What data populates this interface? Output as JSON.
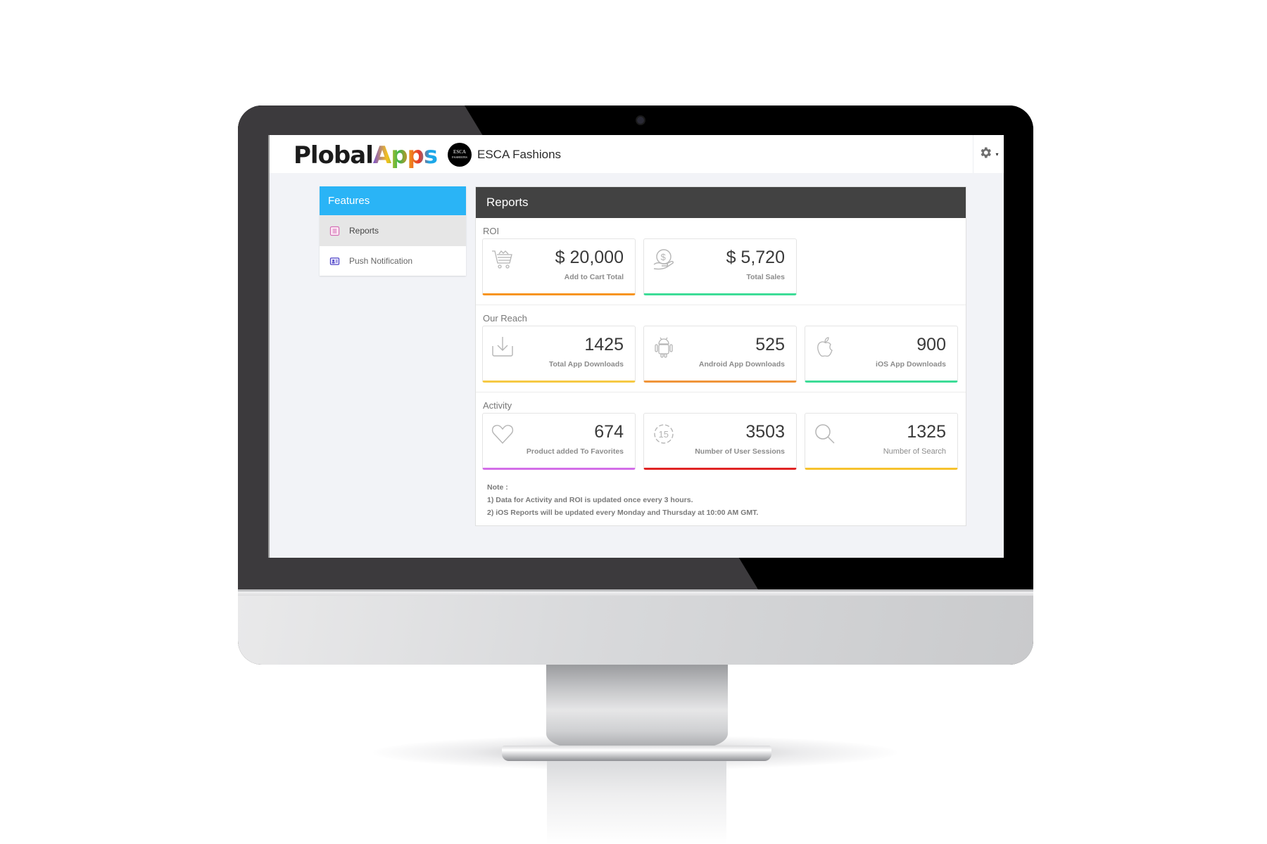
{
  "app": {
    "brand_prefix": "Plobal",
    "brand_suffix": "Apps",
    "store_logo_line1": "ESCA",
    "store_logo_line2": "FASHIONS",
    "store_name": "ESCA Fashions",
    "settings_caret": "▾"
  },
  "sidebar": {
    "title": "Features",
    "items": [
      {
        "label": "Reports",
        "icon": "report-list-icon",
        "active": true
      },
      {
        "label": "Push Notification",
        "icon": "id-card-icon",
        "active": false
      }
    ]
  },
  "reports": {
    "title": "Reports",
    "sections": [
      {
        "title": "ROI",
        "cards": [
          {
            "value": "$ 20,000",
            "label": "Add to Cart Total",
            "icon": "shopping-cart-icon",
            "accent": "#f7941d"
          },
          {
            "value": "$ 5,720",
            "label": "Total Sales",
            "icon": "money-hand-icon",
            "accent": "#3ddc97"
          }
        ]
      },
      {
        "title": "Our Reach",
        "cards": [
          {
            "value": "1425",
            "label": "Total App Downloads",
            "icon": "download-icon",
            "accent": "#f6c944"
          },
          {
            "value": "525",
            "label": "Android App Downloads",
            "icon": "android-icon",
            "accent": "#f0953a"
          },
          {
            "value": "900",
            "label": "iOS App Downloads",
            "icon": "apple-icon",
            "accent": "#3ddc97"
          }
        ]
      },
      {
        "title": "Activity",
        "cards": [
          {
            "value": "674",
            "label": "Product added To Favorites",
            "icon": "heart-icon",
            "accent": "#d36ee8"
          },
          {
            "value": "3503",
            "label": "Number of User Sessions",
            "icon": "timer-15-icon",
            "accent": "#e02424"
          },
          {
            "value": "1325",
            "label": "Number of Search",
            "icon": "search-icon",
            "accent": "#f6c22e"
          }
        ]
      }
    ],
    "note": {
      "title": "Note :",
      "lines": [
        "1) Data for Activity and ROI is updated once every 3 hours.",
        "2) iOS Reports will be updated every Monday and Thursday at 10:00 AM GMT."
      ]
    }
  }
}
